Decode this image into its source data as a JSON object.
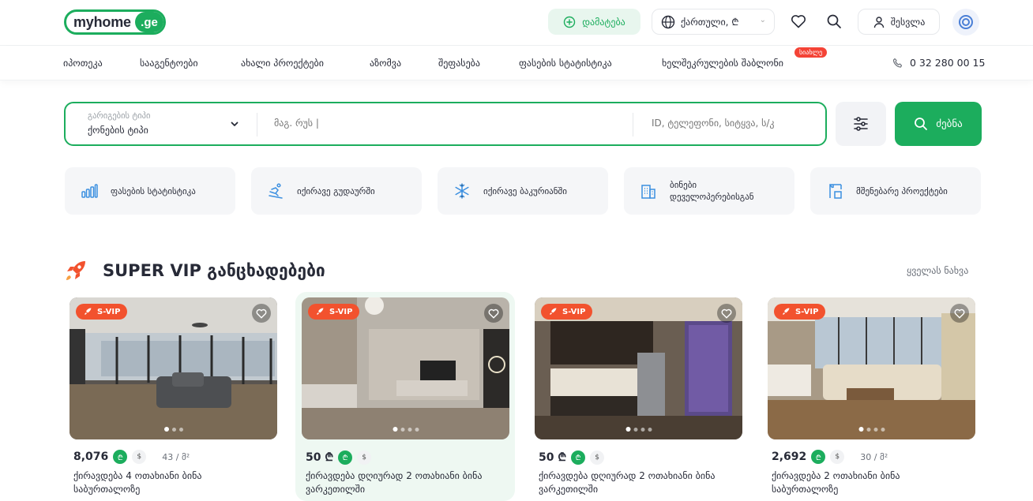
{
  "header": {
    "logo_my": "myhome",
    "logo_ge": ".ge",
    "add_label": "დამატება",
    "language_label": "ქართული, ₾",
    "login_label": "შესვლა"
  },
  "nav": {
    "items": [
      "იპოთეკა",
      "სააგენტოები",
      "ახალი პროექტები",
      "აზომვა",
      "შეფასება",
      "ფასების სტატისტიკა",
      "ხელშეკრულების შაბლონი"
    ],
    "new_badge": "სიახლე",
    "phone": "0 32 280 00 15"
  },
  "search": {
    "type_label": "გარიგების ტიპი",
    "type_value": "ქონების ტიპი",
    "location_placeholder": "მაგ. რუს |",
    "id_placeholder": "ID, ტელეფონი, სიტყვა, ს/კ",
    "search_label": "ძებნა"
  },
  "quick_links": [
    "ფასების სტატისტიკა",
    "იქირავე გუდაურში",
    "იქირავე ბაკურიანში",
    "ბინები დეველოპერებისგან",
    "მშენებარე პროექტები"
  ],
  "section": {
    "title": "SUPER VIP განცხადებები",
    "see_all": "ყველას ნახვა"
  },
  "cards": [
    {
      "badge": "S-VIP",
      "price": "8,076",
      "gel": "₾",
      "usd": "$",
      "area": "43 / მ²",
      "title": "ქირავდება 4 ოთახიანი ბინა საბურთალოზე"
    },
    {
      "badge": "S-VIP",
      "price": "50 ₾",
      "gel": "₾",
      "usd": "$",
      "area": "",
      "title": "ქირავდება დღიურად 2 ოთახიანი ბინა ვარკეთილში"
    },
    {
      "badge": "S-VIP",
      "price": "50 ₾",
      "gel": "₾",
      "usd": "$",
      "area": "",
      "title": "ქირავდება დღიურად 2 ოთახიანი ბინა ვარკეთილში"
    },
    {
      "badge": "S-VIP",
      "price": "2,692",
      "gel": "₾",
      "usd": "$",
      "area": "30 / მ²",
      "title": "ქირავდება 2 ოთახიანი ბინა საბურთალოზე"
    }
  ],
  "colors": {
    "brand_green": "#1cad5d",
    "svip_orange": "#f2522e",
    "badge_red": "#f44336"
  }
}
